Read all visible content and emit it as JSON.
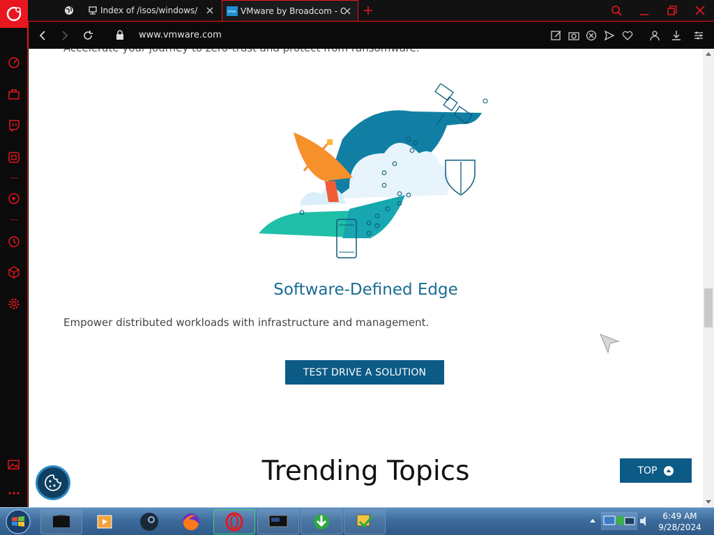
{
  "browser": {
    "tabs": [
      {
        "title": ""
      },
      {
        "title": "Index of /isos/windows/"
      },
      {
        "title": "VMware by Broadcom - Cl"
      }
    ],
    "url": "www.vmware.com"
  },
  "page": {
    "top_text": "Accelerate your journey to zero-trust and protect from ransomware.",
    "section_title": "Software-Defined Edge",
    "section_desc": "Empower distributed workloads with infrastructure and management.",
    "cta_label": "TEST DRIVE A SOLUTION",
    "trending_title": "Trending Topics",
    "top_button_label": "TOP"
  },
  "taskbar": {
    "time": "6:49 AM",
    "date": "9/28/2024",
    "apps": [
      "task-manager-like",
      "media-player",
      "steam",
      "firefox",
      "opera",
      "monitor-app",
      "idm",
      "setup-app"
    ]
  },
  "colors": {
    "opera_red": "#e8161f",
    "vmware_blue": "#0c5a86",
    "title_blue": "#1b6b93",
    "teal": "#1fbfa8",
    "orange": "#f5902b"
  }
}
